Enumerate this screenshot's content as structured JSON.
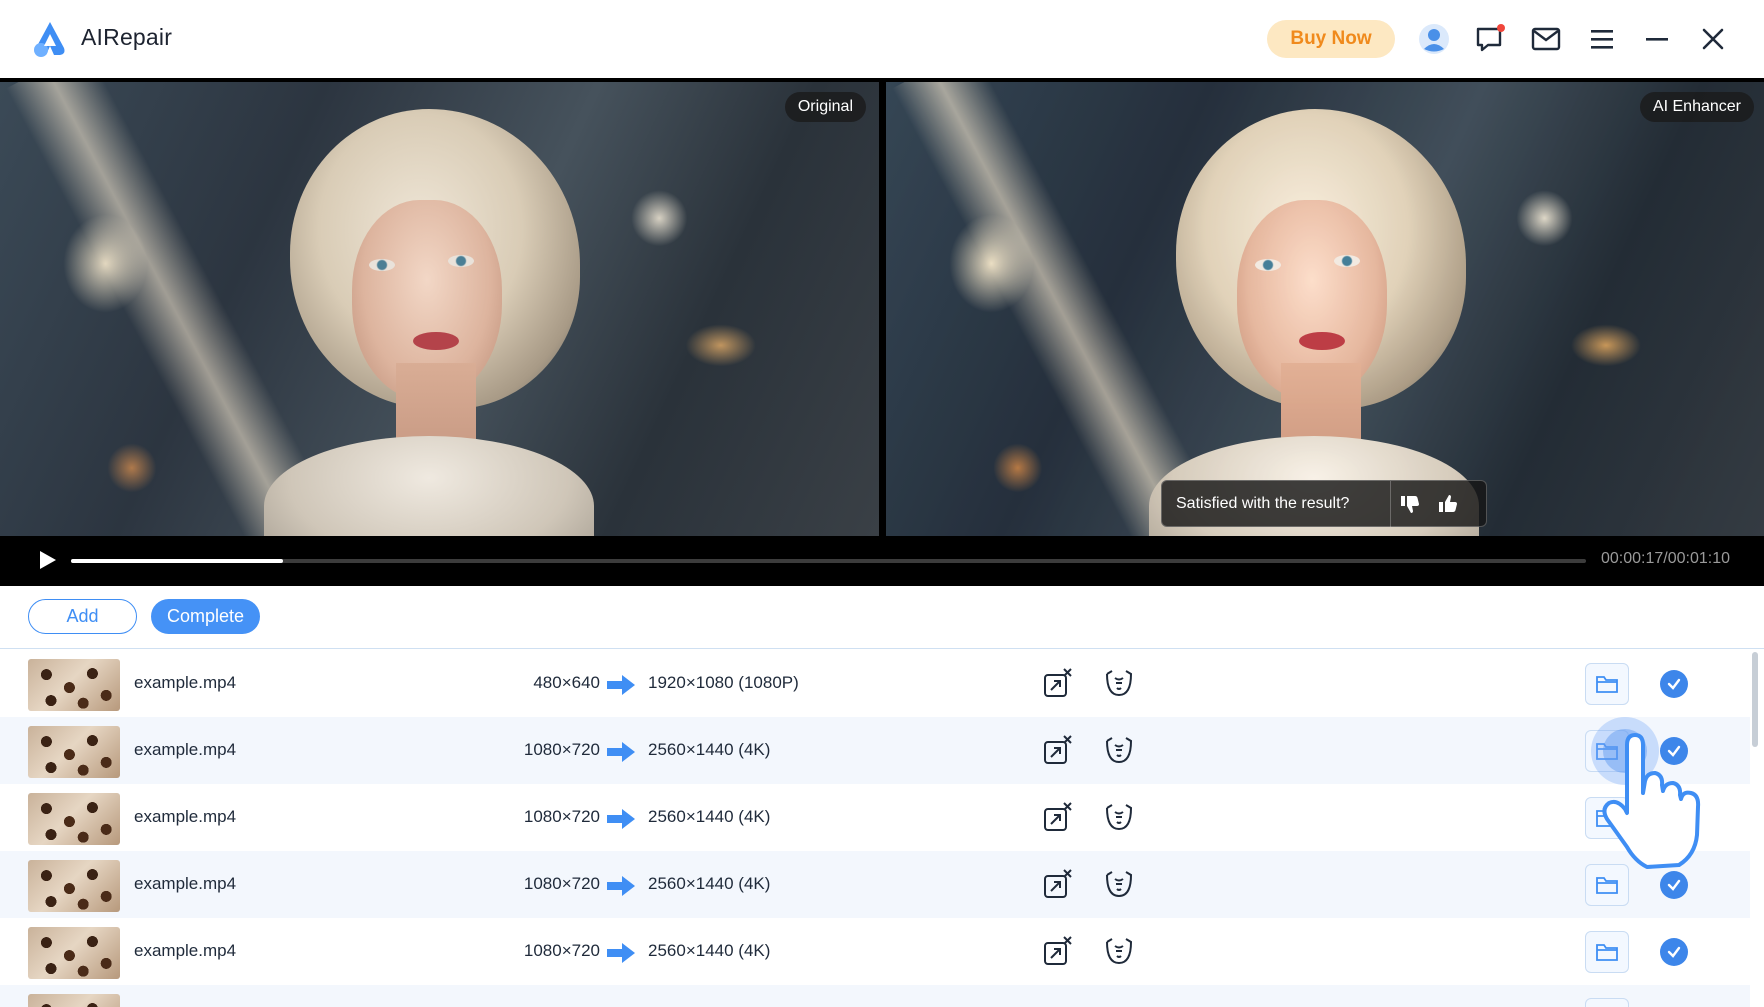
{
  "app": {
    "name": "AIRepair"
  },
  "header": {
    "buy_label": "Buy Now",
    "icons": [
      "account-icon",
      "feedback-icon",
      "mail-icon",
      "menu-icon",
      "minimize-icon",
      "close-icon"
    ]
  },
  "preview": {
    "left_tag": "Original",
    "right_tag": "AI Enhancer",
    "feedback_question": "Satisfied with the result?",
    "timecode": "00:00:17/00:01:10",
    "progress_fraction": 0.14
  },
  "toolbar": {
    "add_label": "Add",
    "complete_label": "Complete"
  },
  "files": [
    {
      "name": "example.mp4",
      "from": "480×640",
      "to": "1920×1080 (1080P)"
    },
    {
      "name": "example.mp4",
      "from": "1080×720",
      "to": "2560×1440 (4K)"
    },
    {
      "name": "example.mp4",
      "from": "1080×720",
      "to": "2560×1440 (4K)"
    },
    {
      "name": "example.mp4",
      "from": "1080×720",
      "to": "2560×1440 (4K)"
    },
    {
      "name": "example.mp4",
      "from": "1080×720",
      "to": "2560×1440 (4K)"
    }
  ],
  "colors": {
    "accent": "#4592f6",
    "buy_bg": "#fde8c2",
    "buy_text": "#f08a1c",
    "done": "#3d86ea"
  }
}
